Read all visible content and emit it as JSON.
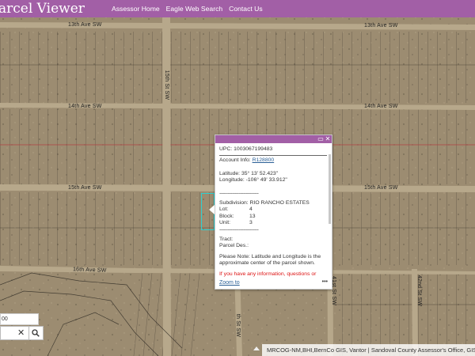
{
  "header": {
    "title": "arcel Viewer",
    "nav": [
      "Assessor Home",
      "Eagle Web Search",
      "Contact Us"
    ]
  },
  "map": {
    "street_labels": [
      "13th Ave SW",
      "13th Ave SW",
      "14th Ave SW",
      "14th Ave SW",
      "15th Ave SW",
      "15th Ave SW",
      "16th Ave SW",
      "15th St SW",
      "41st St SW",
      "42nd St SW",
      "th St SW"
    ]
  },
  "popup": {
    "upc_label": "UPC:",
    "upc": "1003067199483",
    "account_label": "Account Info:",
    "account": "R128800",
    "latitude_label": "Latitude:",
    "latitude": "35° 13' 52.423\"",
    "longitude_label": "Longitude:",
    "longitude": "-106° 49' 33.912\"",
    "separator": "----------------------------",
    "subdivision_label": "Subdivision:",
    "subdivision": "RIO RANCHO ESTATES",
    "lot_label": "Lot:",
    "lot": "4",
    "block_label": "Block:",
    "block": "13",
    "unit_label": "Unit:",
    "unit": "3",
    "tract_label": "Tract:",
    "parcel_des_label": "Parcel Des.:",
    "note": "Please Note: Latitude and Longitude is the approximate center of the parcel shown.",
    "warning": "If you have any information, questions or",
    "zoom_link": "Zoom to",
    "more": "•••"
  },
  "search": {
    "value": "00",
    "clear": "✕"
  },
  "attribution": "MRCOG-NM,BHI,BernCo GIS, Vantor | Sandoval County Assessor's Office, GIS Map",
  "colors": {
    "header": "#a25fa6",
    "parcel_highlight": "#2ed0d0",
    "link": "#2a5f96"
  }
}
